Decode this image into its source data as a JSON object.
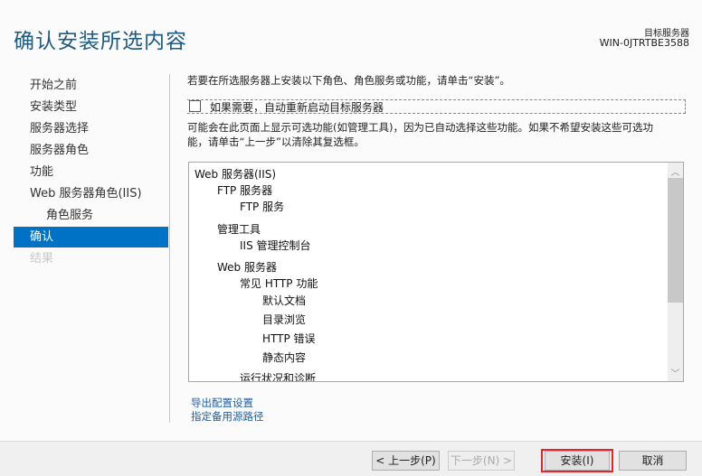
{
  "header": {
    "title": "确认安装所选内容",
    "target_label": "目标服务器",
    "target_name": "WIN-0JTRTBE3588"
  },
  "nav": [
    {
      "label": "开始之前"
    },
    {
      "label": "安装类型"
    },
    {
      "label": "服务器选择"
    },
    {
      "label": "服务器角色"
    },
    {
      "label": "功能"
    },
    {
      "label": "Web 服务器角色(IIS)"
    },
    {
      "label": "角色服务"
    },
    {
      "label": "确认"
    },
    {
      "label": "结果"
    }
  ],
  "main": {
    "intro": "若要在所选服务器上安装以下角色、角色服务或功能，请单击“安装”。",
    "restart_checkbox": {
      "label": "如果需要，自动重新启动目标服务器",
      "checked": false
    },
    "note_line1": "可能会在此页面上显示可选功能(如管理工具)，因为已自动选择这些功能。如果不希望安装这些可选功",
    "note_line2": "能，请单击“上一步”以清除其复选框。",
    "items": [
      "Web 服务器(IIS)",
      "FTP 服务器",
      "FTP 服务",
      "管理工具",
      "IIS 管理控制台",
      "Web 服务器",
      "常见 HTTP 功能",
      "默认文档",
      "目录浏览",
      "HTTP 错误",
      "静态内容",
      "运行状况和诊断"
    ],
    "links": {
      "export": "导出配置设置",
      "alt_source": "指定备用源路径"
    }
  },
  "footer": {
    "prev": "< 上一步(P)",
    "next": "下一步(N) >",
    "install": "安装(I)",
    "cancel": "取消"
  }
}
